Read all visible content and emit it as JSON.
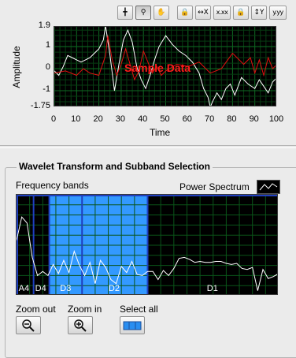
{
  "toolbar": {
    "buttons": [
      {
        "icon": "crosshair-cursor-icon",
        "glyph": "╋",
        "active": false
      },
      {
        "icon": "zoom-magnifier-icon",
        "glyph": "⚲",
        "active": true
      },
      {
        "icon": "pan-hand-icon",
        "glyph": "✋",
        "active": false
      },
      {
        "icon": "lock-icon",
        "glyph": "🔒",
        "active": false
      },
      {
        "icon": "x-autoscale-icon",
        "glyph": "↔X",
        "active": false
      },
      {
        "icon": "x-format-icon",
        "glyph": "x.xx",
        "active": false
      },
      {
        "icon": "lock-icon",
        "glyph": "🔒",
        "active": false
      },
      {
        "icon": "y-autoscale-icon",
        "glyph": "↕Y",
        "active": false
      },
      {
        "icon": "y-format-icon",
        "glyph": "y.yy",
        "active": false
      }
    ]
  },
  "signal_graph": {
    "overlay_label": "Sample Data",
    "ylabel": "Amplitude",
    "xlabel": "Time",
    "y_ticks": [
      "1.9",
      "1",
      "0",
      "-1",
      "-1.75"
    ],
    "x_ticks": [
      "0",
      "10",
      "20",
      "30",
      "40",
      "50",
      "60",
      "70",
      "80",
      "90",
      "100"
    ],
    "colors": {
      "white_series": "#ffffff",
      "red_series": "#e01010",
      "grid": "#0b5a1c",
      "background": "#000000"
    }
  },
  "section": {
    "title": "Wavelet Transform and Subband Selection",
    "frequency_label": "Frequency bands",
    "legend_label": "Power Spectrum"
  },
  "bands": [
    {
      "label": "A4",
      "selected": false
    },
    {
      "label": "D4",
      "selected": false
    },
    {
      "label": "D3",
      "selected": true
    },
    {
      "label": "D2",
      "selected": true
    },
    {
      "label": "D1",
      "selected": false
    }
  ],
  "controls": {
    "zoom_out_label": "Zoom out",
    "zoom_in_label": "Zoom in",
    "select_all_label": "Select all"
  },
  "chart_data": [
    {
      "type": "line",
      "xlabel": "Time",
      "ylabel": "Amplitude",
      "xlim": [
        0,
        100
      ],
      "ylim": [
        -1.75,
        1.9
      ],
      "series": [
        {
          "name": "",
          "color": "#ffffff",
          "x": [
            0,
            2,
            4,
            6,
            8,
            10,
            12,
            14,
            16,
            18,
            20,
            22,
            23,
            25,
            27,
            29,
            31,
            33,
            35,
            37,
            39,
            41,
            43,
            45,
            47,
            50,
            53,
            56,
            59,
            62,
            65,
            67,
            69,
            70,
            71,
            73,
            75,
            77,
            79,
            81,
            84,
            87,
            90,
            92,
            94,
            96,
            98,
            100
          ],
          "y": [
            -0.1,
            -0.3,
            0.1,
            0.6,
            0.5,
            0.4,
            0.3,
            0.4,
            0.5,
            0.7,
            0.9,
            1.3,
            1.95,
            0.6,
            -1.0,
            0.2,
            1.3,
            1.75,
            1.2,
            0.1,
            -0.5,
            -0.9,
            -0.3,
            0.4,
            1.0,
            1.5,
            1.1,
            0.8,
            0.6,
            0.3,
            -0.2,
            -0.9,
            -1.3,
            -1.75,
            -1.5,
            -1.1,
            -1.4,
            -0.9,
            -0.7,
            -1.2,
            -0.4,
            -0.7,
            -0.9,
            -0.5,
            -0.8,
            -1.1,
            -0.6,
            -0.4
          ]
        },
        {
          "name": "",
          "color": "#e01010",
          "x": [
            0,
            5,
            10,
            13,
            16,
            20,
            23,
            24,
            26,
            28,
            30,
            32,
            34,
            36,
            38,
            40,
            42,
            44,
            46,
            48,
            50,
            55,
            60,
            65,
            70,
            75,
            80,
            85,
            88,
            90,
            92,
            94,
            96,
            98,
            100
          ],
          "y": [
            -0.2,
            -0.1,
            -0.3,
            0.0,
            -0.2,
            -0.3,
            0.6,
            1.5,
            0.4,
            -0.3,
            0.2,
            0.9,
            0.2,
            -0.5,
            -0.1,
            0.8,
            0.3,
            -0.2,
            0.1,
            -0.3,
            -0.1,
            0.2,
            0.1,
            0.3,
            -0.2,
            0.0,
            0.7,
            0.2,
            0.5,
            -0.2,
            0.4,
            -0.3,
            0.5,
            0.0,
            0.2
          ]
        }
      ]
    },
    {
      "type": "line",
      "title": "Frequency bands",
      "series": [
        {
          "name": "Power Spectrum",
          "color": "#ffffff",
          "x": [
            0,
            2,
            4,
            6,
            8,
            10,
            12,
            14,
            16,
            18,
            20,
            22,
            24,
            26,
            28,
            30,
            32,
            34,
            36,
            38,
            40,
            42,
            44,
            46,
            48,
            50,
            52,
            54,
            56,
            58,
            60,
            62,
            64,
            66,
            68,
            70,
            72,
            74,
            76,
            78,
            80,
            82,
            84,
            86,
            88,
            90,
            92,
            94,
            96,
            98,
            100
          ],
          "y": [
            0.55,
            0.78,
            0.72,
            0.38,
            0.2,
            0.24,
            0.2,
            0.31,
            0.22,
            0.35,
            0.23,
            0.44,
            0.3,
            0.2,
            0.33,
            0.12,
            0.35,
            0.28,
            0.16,
            0.12,
            0.29,
            0.23,
            0.34,
            0.21,
            0.2,
            0.24,
            0.24,
            0.16,
            0.25,
            0.2,
            0.27,
            0.37,
            0.38,
            0.36,
            0.33,
            0.34,
            0.33,
            0.33,
            0.34,
            0.34,
            0.32,
            0.31,
            0.32,
            0.27,
            0.26,
            0.28,
            0.05,
            0.26,
            0.17,
            0.19,
            0.22
          ]
        }
      ]
    }
  ]
}
